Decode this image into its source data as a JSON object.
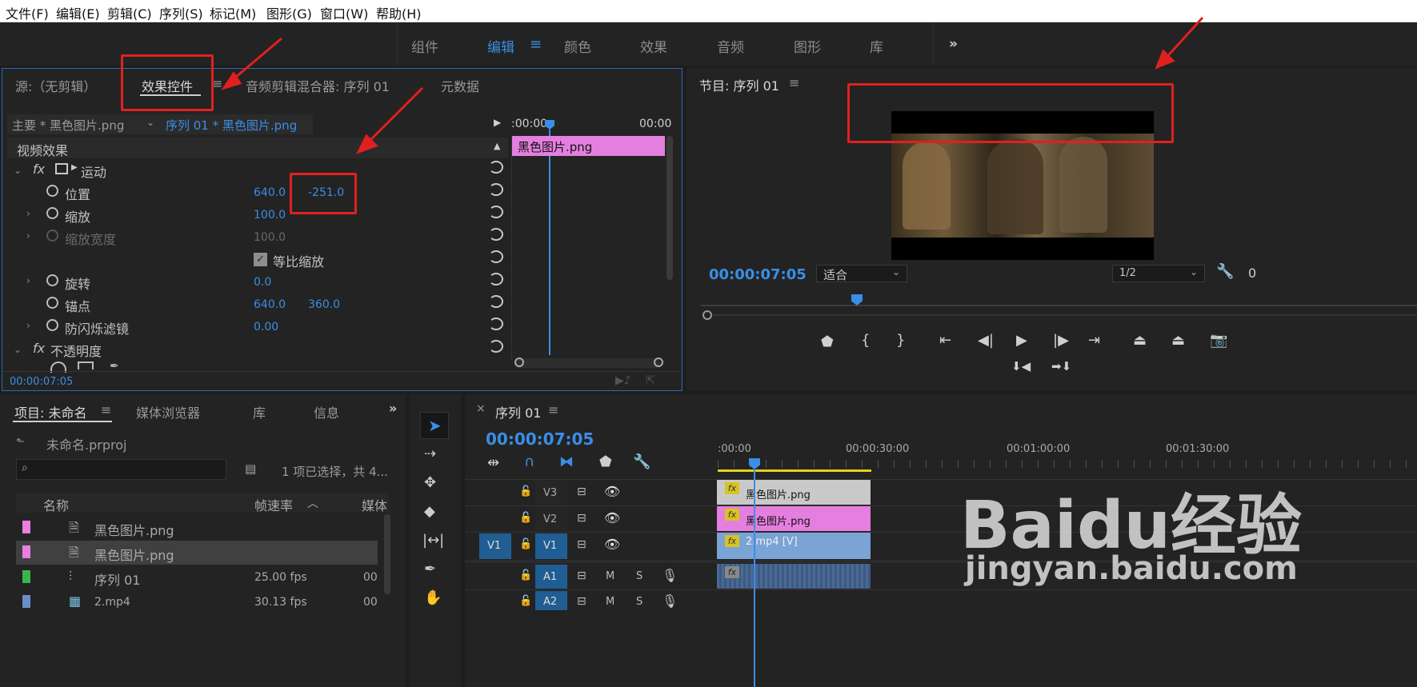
{
  "menu": [
    "文件(F)",
    "编辑(E)",
    "剪辑(C)",
    "序列(S)",
    "标记(M)",
    "图形(G)",
    "窗口(W)",
    "帮助(H)"
  ],
  "workspaces": [
    "组件",
    "编辑",
    "颜色",
    "效果",
    "音频",
    "图形",
    "库"
  ],
  "workspace_active": "编辑",
  "top_left_tabs": {
    "source": "源:（无剪辑）",
    "effect_controls": "效果控件",
    "audio_mixer": "音频剪辑混合器: 序列 01",
    "metadata": "元数据"
  },
  "effect_controls": {
    "master_clip": "主要 * 黑色图片.png",
    "sequence_clip": "序列 01 * 黑色图片.png",
    "ruler_start": ":00:00",
    "ruler_end": "00:00",
    "mini_clip": "黑色图片.png",
    "video_effects_header": "视频效果",
    "motion": "运动",
    "rows": [
      {
        "label": "位置",
        "v1": "640.0",
        "v2": "-251.0"
      },
      {
        "label": "缩放",
        "v1": "100.0"
      },
      {
        "label": "缩放宽度",
        "v1": "100.0"
      },
      {
        "label": "旋转",
        "v1": "0.0"
      },
      {
        "label": "锚点",
        "v1": "640.0",
        "v2": "360.0"
      },
      {
        "label": "防闪烁滤镜",
        "v1": "0.00"
      }
    ],
    "uniform_scale": "等比缩放",
    "opacity": "不透明度",
    "fx": "fx",
    "timecode": "00:00:07:05"
  },
  "program": {
    "title": "节目: 序列 01",
    "timecode": "00:00:07:05",
    "fit": "适合",
    "resolution": "1/2"
  },
  "project": {
    "tabs": {
      "project": "项目: 未命名",
      "media_browser": "媒体浏览器",
      "libraries": "库",
      "info": "信息"
    },
    "file": "未命名.prproj",
    "selection": "1 项已选择，共 4...",
    "columns": {
      "name": "名称",
      "fps": "帧速率",
      "media": "媒体"
    },
    "items": [
      {
        "name": "黑色图片.png",
        "fps": "",
        "extra": "",
        "color": "#e97fe0"
      },
      {
        "name": "黑色图片.png",
        "fps": "",
        "extra": "",
        "color": "#e97fe0"
      },
      {
        "name": "序列 01",
        "fps": "25.00 fps",
        "extra": "00",
        "color": "#3bb54a"
      },
      {
        "name": "2.mp4",
        "fps": "30.13 fps",
        "extra": "00",
        "color": "#6a8fc8"
      }
    ]
  },
  "timeline": {
    "title": "序列 01",
    "timecode": "00:00:07:05",
    "ruler": [
      ":00:00",
      "00:00:30:00",
      "00:01:00:00",
      "00:01:30:00"
    ],
    "tracks": [
      {
        "name": "V3",
        "clip": "黑色图片.png"
      },
      {
        "name": "V2",
        "clip": "黑色图片.png"
      },
      {
        "name": "V1",
        "clip": "2.mp4 [V]",
        "src": "V1"
      },
      {
        "name": "A1",
        "clip": ""
      },
      {
        "name": "A2",
        "clip": ""
      }
    ],
    "audio_m": "M",
    "audio_s": "S"
  },
  "watermark": {
    "brand": "Baidu经验",
    "url": "jingyan.baidu.com"
  }
}
